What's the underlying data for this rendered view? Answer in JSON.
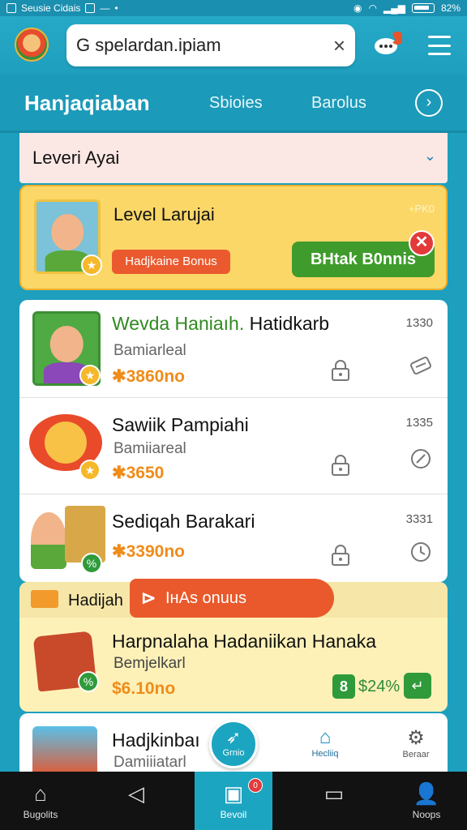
{
  "status_bar": {
    "app_name": "Seusie Cidais",
    "battery": "82%"
  },
  "header": {
    "search_value": "G spelardan.ipiam",
    "clear": "×"
  },
  "tabs": {
    "active": "Hanjaqiaban",
    "tab_2": "Sbioies",
    "tab_3": "Barolus",
    "next": "›"
  },
  "section": {
    "title": "Leveri Ayai",
    "chevron": "⌄"
  },
  "level_card": {
    "title": "Level Larujai",
    "corner": "+PK0",
    "bonus_pill": "Hadjkaine Bonus",
    "button": "BHtak B0nnis",
    "close": "✕"
  },
  "items": [
    {
      "title_accent": "Wevda Haniaıh.",
      "title_rest": " Hatidkarb",
      "subtitle": "Bamiarleal",
      "price": "✱3860no",
      "number": "1330"
    },
    {
      "title": "Sawiik Pampiahi",
      "subtitle": "Bamiiareal",
      "price": "✱3650",
      "number": "1335"
    },
    {
      "title": "Sediqah Barakari",
      "price": "✱3390no",
      "number": "3331"
    }
  ],
  "promo": {
    "strip_label": "Hadijah",
    "banner": "ІнАs onuus",
    "banner_arrow": "⊳",
    "title": "Harpnalaha Hadaniikan Hanaka",
    "subtitle": "Bemjelkarl",
    "price": "$6.10no",
    "badge_8": "8",
    "percent": "$24%",
    "badge_arrow": "↵"
  },
  "last_item": {
    "title": "Hadjkinbaı",
    "subtitle": "Damiiiatarl"
  },
  "fab": {
    "label": "Grnio"
  },
  "mini_nav": [
    {
      "label": "Hecliiq"
    },
    {
      "label": "Beraar"
    }
  ],
  "bottom_nav": [
    {
      "label": "Bugolits"
    },
    {
      "label": ""
    },
    {
      "label": "Bevoil",
      "badge": "0"
    },
    {
      "label": ""
    },
    {
      "label": "Noops"
    }
  ],
  "colors": {
    "primary": "#1e9fbd",
    "accent_orange": "#ea5a2e",
    "accent_green": "#3f9b2c",
    "price": "#ef8c1a",
    "title_green": "#2f8a1f"
  }
}
